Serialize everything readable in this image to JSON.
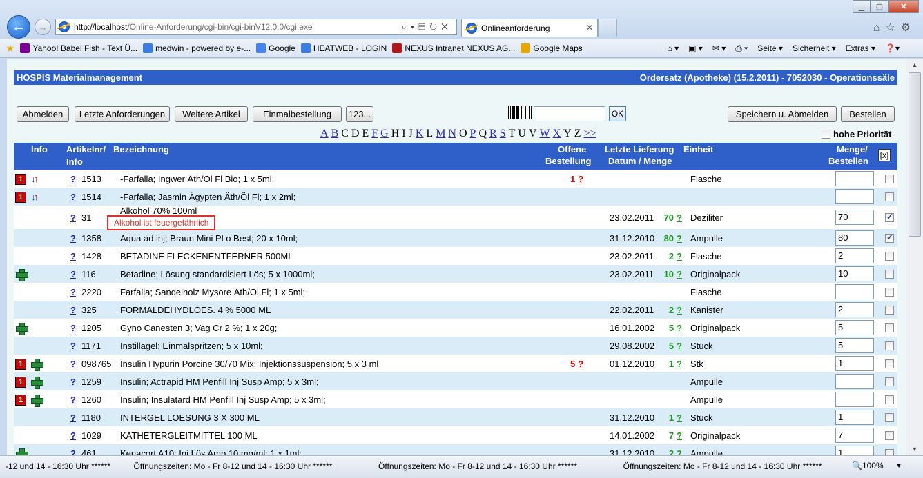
{
  "browser": {
    "url_host": "http://localhost",
    "url_rest": "/Online-Anforderung/cgi-bin/cgi-binV12.0.0/cgi.exe",
    "tab_title": "Onlineanforderung",
    "favorites": [
      {
        "label": "Yahoo! Babel Fish - Text Ü...",
        "icon": "yahoo-icon",
        "color": "#7b0099"
      },
      {
        "label": "medwin - powered by e-...",
        "icon": "page-icon",
        "color": "#3b7de0"
      },
      {
        "label": "Google",
        "icon": "google-icon",
        "color": "#4285f4"
      },
      {
        "label": "HEATWEB - LOGIN",
        "icon": "ie-page-icon",
        "color": "#3b7de0"
      },
      {
        "label": "NEXUS Intranet NEXUS AG...",
        "icon": "nexus-icon",
        "color": "#b01818"
      },
      {
        "label": "Google Maps",
        "icon": "google-maps-icon",
        "color": "#e6a700"
      }
    ],
    "commands": [
      "Seite ▾",
      "Sicherheit ▾",
      "Extras ▾"
    ],
    "status_text": "-12 und 14 - 16:30 Uhr ******          Öffnungszeiten: Mo - Fr 8-12 und 14 - 16:30 Uhr ******                    Öffnungszeiten: Mo - Fr 8-12 und 14 - 16:30 Uhr ******                    Öffnungszeiten: Mo - Fr 8-12 und 14 - 16:30 Uhr ******",
    "zoom": "100%"
  },
  "app": {
    "title": "HOSPIS Materialmanagement",
    "order_set": "Ordersatz (Apotheke) (15.2.2011) - 7052030 - Operationssäle"
  },
  "toolbar": {
    "logout": "Abmelden",
    "last_requests": "Letzte Anforderungen",
    "more_items": "Weitere Artikel",
    "single_order": "Einmalbestellung",
    "num": "123...",
    "ok": "OK",
    "save_logout": "Speichern u. Abmelden",
    "order": "Bestellen",
    "priority": "hohe Priorität"
  },
  "alphabet": [
    {
      "l": "A",
      "link": true
    },
    {
      "l": "B",
      "link": true
    },
    {
      "l": "C",
      "link": false
    },
    {
      "l": "D",
      "link": false
    },
    {
      "l": "E",
      "link": false
    },
    {
      "l": "F",
      "link": true
    },
    {
      "l": "G",
      "link": true
    },
    {
      "l": "H",
      "link": false
    },
    {
      "l": "I",
      "link": false
    },
    {
      "l": "J",
      "link": false
    },
    {
      "l": "K",
      "link": true
    },
    {
      "l": "L",
      "link": false
    },
    {
      "l": "M",
      "link": true
    },
    {
      "l": "N",
      "link": true
    },
    {
      "l": "O",
      "link": false
    },
    {
      "l": "P",
      "link": true
    },
    {
      "l": "Q",
      "link": false
    },
    {
      "l": "R",
      "link": true
    },
    {
      "l": "S",
      "link": true
    },
    {
      "l": "T",
      "link": false
    },
    {
      "l": "U",
      "link": false
    },
    {
      "l": "V",
      "link": false
    },
    {
      "l": "W",
      "link": true
    },
    {
      "l": "X",
      "link": true
    },
    {
      "l": "Y",
      "link": false
    },
    {
      "l": "Z",
      "link": false
    },
    {
      "l": ">>",
      "link": true
    }
  ],
  "table": {
    "headers": {
      "info": "Info",
      "artikel1": "Artikelnr/",
      "artikel2": "Info",
      "bezeichnung": "Bezeichnung",
      "offene1": "Offene",
      "offene2": "Bestellung",
      "lieferung1": "Letzte Lieferung",
      "lieferung2": "Datum / Menge",
      "einheit": "Einheit",
      "menge1": "Menge/",
      "menge2": "Bestellen",
      "clear": "[x]"
    },
    "rows": [
      {
        "badge": true,
        "arrows": true,
        "plus": false,
        "nr": "1513",
        "name": "-Farfalla; Ingwer Äth/Öl Fl Bio; 1 x 5ml;",
        "open": "1",
        "date": "",
        "qty": "",
        "unit": "Flasche",
        "order": "",
        "checked": false
      },
      {
        "badge": true,
        "arrows": true,
        "plus": false,
        "nr": "1514",
        "name": "-Farfalla; Jasmin Ägypten Äth/Öl Fl; 1 x 2ml;",
        "open": "",
        "date": "",
        "qty": "",
        "unit": "",
        "order": "",
        "checked": false
      },
      {
        "badge": false,
        "arrows": false,
        "plus": false,
        "nr": "31",
        "name": "Alkohol 70% 100ml",
        "open": "",
        "date": "23.02.2011",
        "qty": "70",
        "unit": "Deziliter",
        "order": "70",
        "checked": true
      },
      {
        "badge": false,
        "arrows": false,
        "plus": false,
        "nr": "1358",
        "name": "Aqua ad inj; Braun Mini Pl o Best; 20 x 10ml;",
        "open": "",
        "date": "31.12.2010",
        "qty": "80",
        "unit": "Ampulle",
        "order": "80",
        "checked": true
      },
      {
        "badge": false,
        "arrows": false,
        "plus": false,
        "nr": "1428",
        "name": "BETADINE FLECKENENTFERNER 500ML",
        "open": "",
        "date": "23.02.2011",
        "qty": "2",
        "unit": "Flasche",
        "order": "2",
        "checked": false
      },
      {
        "badge": false,
        "arrows": false,
        "plus": true,
        "nr": "116",
        "name": "Betadine; Lösung standardisiert Lös; 5 x 1000ml;",
        "open": "",
        "date": "23.02.2011",
        "qty": "10",
        "unit": "Originalpack",
        "order": "10",
        "checked": false
      },
      {
        "badge": false,
        "arrows": false,
        "plus": false,
        "nr": "2220",
        "name": "Farfalla; Sandelholz Mysore Äth/Öl Fl; 1 x 5ml;",
        "open": "",
        "date": "",
        "qty": "",
        "unit": "Flasche",
        "order": "",
        "checked": false
      },
      {
        "badge": false,
        "arrows": false,
        "plus": false,
        "nr": "325",
        "name": "FORMALDEHYDLOES. 4 % 5000 ML",
        "open": "",
        "date": "22.02.2011",
        "qty": "2",
        "unit": "Kanister",
        "order": "2",
        "checked": false
      },
      {
        "badge": false,
        "arrows": false,
        "plus": true,
        "nr": "1205",
        "name": "Gyno Canesten 3; Vag Cr 2 %; 1 x 20g;",
        "open": "",
        "date": "16.01.2002",
        "qty": "5",
        "unit": "Originalpack",
        "order": "5",
        "checked": false
      },
      {
        "badge": false,
        "arrows": false,
        "plus": false,
        "nr": "1171",
        "name": "Instillagel; Einmalspritzen; 5 x 10ml;",
        "open": "",
        "date": "29.08.2002",
        "qty": "5",
        "unit": "Stück",
        "order": "5",
        "checked": false
      },
      {
        "badge": true,
        "arrows": false,
        "plus": true,
        "nr": "098765",
        "name": "Insulin Hypurin Porcine 30/70 Mix; Injektionssuspension; 5 x 3 ml",
        "open": "5",
        "date": "01.12.2010",
        "qty": "1",
        "unit": "Stk",
        "order": "1",
        "checked": false
      },
      {
        "badge": true,
        "arrows": false,
        "plus": true,
        "nr": "1259",
        "name": "Insulin; Actrapid HM Penfill Inj Susp Amp; 5 x 3ml;",
        "open": "",
        "date": "",
        "qty": "",
        "unit": "Ampulle",
        "order": "",
        "checked": false
      },
      {
        "badge": true,
        "arrows": false,
        "plus": true,
        "nr": "1260",
        "name": "Insulin; Insulatard HM Penfill Inj Susp Amp; 5 x 3ml;",
        "open": "",
        "date": "",
        "qty": "",
        "unit": "Ampulle",
        "order": "",
        "checked": false
      },
      {
        "badge": false,
        "arrows": false,
        "plus": false,
        "nr": "1180",
        "name": "INTERGEL LOESUNG 3 X 300 ML",
        "open": "",
        "date": "31.12.2010",
        "qty": "1",
        "unit": "Stück",
        "order": "1",
        "checked": false
      },
      {
        "badge": false,
        "arrows": false,
        "plus": false,
        "nr": "1029",
        "name": "KATHETERGLEITMITTEL 100 ML",
        "open": "",
        "date": "14.01.2002",
        "qty": "7",
        "unit": "Originalpack",
        "order": "7",
        "checked": false
      },
      {
        "badge": false,
        "arrows": false,
        "plus": true,
        "nr": "461",
        "name": "Kenacort A10; Inj Lös Amp 10 mg/ml; 1 x 1ml;",
        "open": "",
        "date": "31.12.2010",
        "qty": "2",
        "unit": "Ampulle",
        "order": "1",
        "checked": false
      }
    ],
    "qmark": "?",
    "tooltip": "Alkohol ist feuergefährlich"
  }
}
